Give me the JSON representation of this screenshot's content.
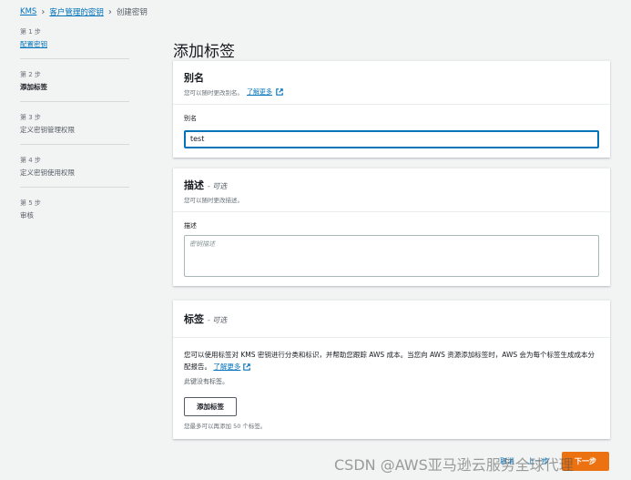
{
  "breadcrumb": {
    "items": [
      "KMS",
      "客户管理的密钥",
      "创建密钥"
    ]
  },
  "steps": [
    {
      "num": "第 1 步",
      "name": "配置密钥"
    },
    {
      "num": "第 2 步",
      "name": "添加标签"
    },
    {
      "num": "第 3 步",
      "name": "定义密钥管理权限"
    },
    {
      "num": "第 4 步",
      "name": "定义密钥使用权限"
    },
    {
      "num": "第 5 步",
      "name": "审核"
    }
  ],
  "page_title": "添加标签",
  "alias": {
    "title": "别名",
    "desc": "您可以随时更改别名。",
    "learn_more": "了解更多",
    "field_label": "别名",
    "value": "test"
  },
  "description": {
    "title": "描述",
    "optional": "- 可选",
    "desc": "您可以随时更改描述。",
    "field_label": "描述",
    "placeholder": "密钥描述"
  },
  "tags": {
    "title": "标签",
    "optional": "- 可选",
    "text": "您可以使用标签对 KMS 密钥进行分类和标识，并帮助您跟踪 AWS 成本。当您向 AWS 资源添加标签时，AWS 会为每个标签生成成本分配报告。",
    "learn_more": "了解更多",
    "none": "此键没有标签。",
    "add_button": "添加标签",
    "hint": "您最多可以再添加 50 个标签。"
  },
  "footer": {
    "cancel": "取消",
    "previous": "上一步",
    "next": "下一步"
  },
  "watermark": "CSDN @AWS亚马逊云服务全球代理",
  "colors": {
    "link": "#0073bb",
    "primary_button": "#ec7211",
    "background": "#f2f3f3"
  }
}
